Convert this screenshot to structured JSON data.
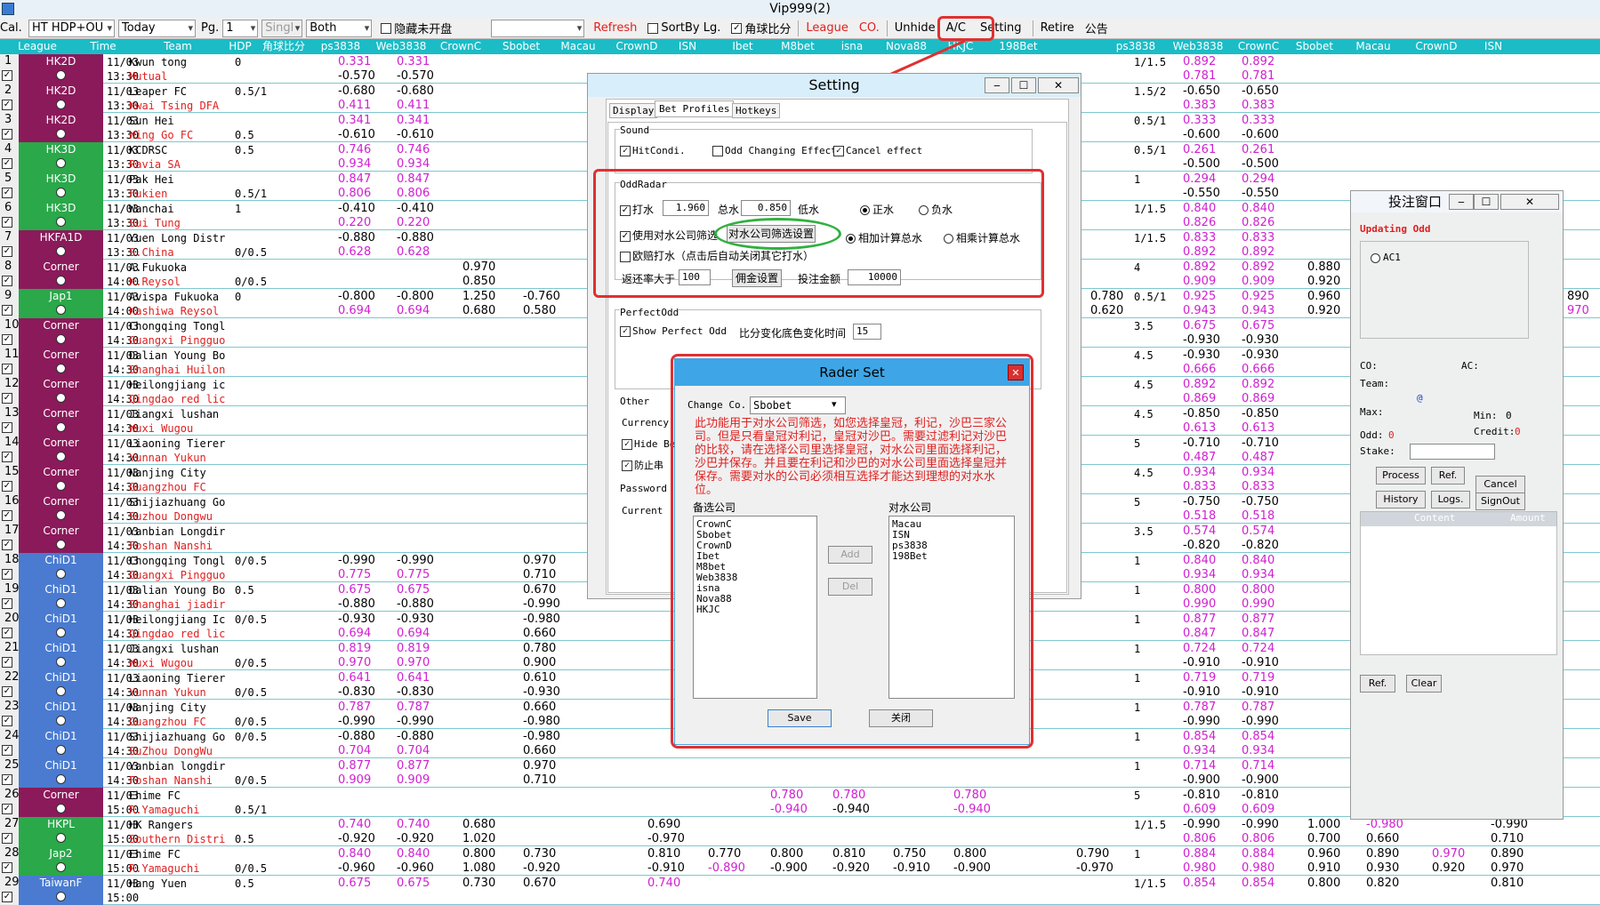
{
  "window": {
    "title": "Vip999(2)"
  },
  "toolbar": {
    "cal": "Cal.",
    "market": "HT HDP+OU",
    "date": "Today",
    "pg_label": "Pg.",
    "page": "1",
    "single": "Singl",
    "both": "Both",
    "hide_unopened": "隐藏未开盘",
    "refresh": "Refresh",
    "sort_by_league": "SortBy Lg.",
    "corner_ratio": "角球比分",
    "league": "League",
    "co": "CO.",
    "unhide": "Unhide",
    "ac": "A/C",
    "setting": "Setting",
    "retire": "Retire",
    "notice": "公告"
  },
  "header": {
    "cols": [
      "League",
      "Time",
      "Team",
      "HDP",
      "角球比分",
      "ps3838",
      "Web3838",
      "CrownC",
      "Sbobet",
      "Macau",
      "CrownD",
      "ISN",
      "Ibet",
      "M8bet",
      "isna",
      "Nova88",
      "HKJC",
      "198Bet",
      "",
      "ps3838",
      "Web3838",
      "CrownC",
      "Sbobet",
      "Macau",
      "CrownD",
      "ISN"
    ]
  },
  "rows": [
    {
      "n": "1",
      "lg": "HK2D",
      "c": "#8b1a5a",
      "d": "11/03",
      "t": "13:30",
      "h": "Kwun tong",
      "a": "Mutual",
      "hdp": "0",
      "hdp2": "",
      "p1": "0.331",
      "p2": "-0.570",
      "w1": "0.331",
      "w2": "-0.570",
      "cc1": "",
      "cc2": "",
      "sb1": "",
      "sb2": "",
      "ou": "1/1.5",
      "r1": "0.892",
      "r2": "0.781",
      "rw1": "0.892",
      "rw2": "0.781"
    },
    {
      "n": "2",
      "lg": "HK2D",
      "c": "#8b1a5a",
      "d": "11/03",
      "t": "13:30",
      "h": "Leaper FC",
      "a": "Kwai Tsing DFA",
      "hdp": "0.5/1",
      "hdp2": "",
      "p1": "-0.680",
      "p2": "0.411",
      "w1": "-0.680",
      "w2": "0.411",
      "cc1": "",
      "cc2": "",
      "sb1": "",
      "sb2": "",
      "ou": "1.5/2",
      "r1": "-0.650",
      "r2": "0.383",
      "rw1": "-0.650",
      "rw2": "0.383"
    },
    {
      "n": "3",
      "lg": "HK2D",
      "c": "#8b1a5a",
      "d": "11/03",
      "t": "13:30",
      "h": "Sun Hei",
      "a": "Wing Go FC",
      "hdp": "",
      "hdp2": "0.5",
      "p1": "0.341",
      "p2": "-0.610",
      "w1": "0.341",
      "w2": "-0.610",
      "cc1": "",
      "cc2": "",
      "sb1": "",
      "sb2": "",
      "ou": "0.5/1",
      "r1": "0.333",
      "r2": "-0.600",
      "rw1": "0.333",
      "rw2": "-0.600"
    },
    {
      "n": "4",
      "lg": "HK3D",
      "c": "#2aa84a",
      "d": "11/03",
      "t": "13:30",
      "h": "KCDRSC",
      "a": "Ravia SA",
      "hdp": "0.5",
      "hdp2": "",
      "p1": "0.746",
      "p2": "0.934",
      "w1": "0.746",
      "w2": "0.934",
      "cc1": "",
      "cc2": "",
      "sb1": "",
      "sb2": "",
      "ou": "0.5/1",
      "r1": "0.261",
      "r2": "-0.500",
      "rw1": "0.261",
      "rw2": "-0.500"
    },
    {
      "n": "5",
      "lg": "HK3D",
      "c": "#2aa84a",
      "d": "11/03",
      "t": "13:30",
      "h": "Pak Hei",
      "a": "Fukien",
      "hdp": "",
      "hdp2": "0.5/1",
      "p1": "0.847",
      "p2": "0.806",
      "w1": "0.847",
      "w2": "0.806",
      "cc1": "",
      "cc2": "",
      "sb1": "",
      "sb2": "",
      "ou": "1",
      "r1": "0.294",
      "r2": "-0.550",
      "rw1": "0.294",
      "rw2": "-0.550"
    },
    {
      "n": "6",
      "lg": "HK3D",
      "c": "#2aa84a",
      "d": "11/03",
      "t": "13:30",
      "h": "Wanchai",
      "a": "Sui Tung",
      "hdp": "1",
      "hdp2": "",
      "p1": "-0.410",
      "p2": "0.220",
      "w1": "-0.410",
      "w2": "0.220",
      "cc1": "",
      "cc2": "",
      "sb1": "",
      "sb2": "",
      "ou": "1/1.5",
      "r1": "0.840",
      "r2": "0.826",
      "rw1": "0.840",
      "rw2": "0.826"
    },
    {
      "n": "7",
      "lg": "HKFA1D",
      "c": "#8b1a5a",
      "d": "11/03",
      "t": "13:30",
      "h": "Yuen Long Distr",
      "a": "S.China",
      "hdp": "",
      "hdp2": "0/0.5",
      "p1": "-0.880",
      "p2": "0.628",
      "w1": "-0.880",
      "w2": "0.628",
      "cc1": "",
      "cc2": "",
      "sb1": "",
      "sb2": "",
      "ou": "1/1.5",
      "r1": "0.833",
      "r2": "0.892",
      "rw1": "0.833",
      "rw2": "0.892"
    },
    {
      "n": "8",
      "lg": "Corner",
      "c": "#8b1a5a",
      "d": "11/03",
      "t": "14:00",
      "h": "A.Fukuoka",
      "a": "K.Reysol",
      "hdp": "",
      "hdp2": "0/0.5",
      "p1": "",
      "p2": "",
      "w1": "",
      "w2": "",
      "cc1": "0.970",
      "cc2": "0.850",
      "sb1": "",
      "sb2": "",
      "ou": "4",
      "r1": "0.892",
      "r2": "0.909",
      "rw1": "0.892",
      "rw2": "0.909"
    },
    {
      "n": "9",
      "lg": "Jap1",
      "c": "#2aa84a",
      "d": "11/03",
      "t": "14:00",
      "h": "Avispa Fukuoka",
      "a": "Kashiwa Reysol",
      "hdp": "0",
      "hdp2": "",
      "p1": "-0.800",
      "p2": "0.694",
      "w1": "-0.800",
      "w2": "0.694",
      "cc1": "1.250",
      "cc2": "0.680",
      "sb1": "-0.760",
      "sb2": "0.580",
      "ou": "0.5/1",
      "r1": "0.925",
      "r2": "0.943",
      "rw1": "0.925",
      "rw2": "0.943"
    },
    {
      "n": "10",
      "lg": "Corner",
      "c": "#8b1a5a",
      "d": "11/03",
      "t": "14:30",
      "h": "Chongqing Tongl",
      "a": "Guangxi Pingguo",
      "hdp": "",
      "hdp2": "",
      "p1": "",
      "p2": "",
      "w1": "",
      "w2": "",
      "cc1": "",
      "cc2": "",
      "sb1": "",
      "sb2": "",
      "ou": "3.5",
      "r1": "0.675",
      "r2": "-0.930",
      "rw1": "0.675",
      "rw2": "-0.930"
    },
    {
      "n": "11",
      "lg": "Corner",
      "c": "#8b1a5a",
      "d": "11/03",
      "t": "14:30",
      "h": "Dalian Young Bo",
      "a": "Shanghai Huilon",
      "hdp": "",
      "hdp2": "",
      "p1": "",
      "p2": "",
      "w1": "",
      "w2": "",
      "cc1": "",
      "cc2": "",
      "sb1": "",
      "sb2": "",
      "ou": "4.5",
      "r1": "-0.930",
      "r2": "0.666",
      "rw1": "-0.930",
      "rw2": "0.666"
    },
    {
      "n": "12",
      "lg": "Corner",
      "c": "#8b1a5a",
      "d": "11/03",
      "t": "14:30",
      "h": "Heilongjiang ic",
      "a": "Qingdao red lic",
      "hdp": "",
      "hdp2": "",
      "p1": "",
      "p2": "",
      "w1": "",
      "w2": "",
      "cc1": "",
      "cc2": "",
      "sb1": "",
      "sb2": "",
      "ou": "4.5",
      "r1": "0.892",
      "r2": "0.869",
      "rw1": "0.892",
      "rw2": "0.869"
    },
    {
      "n": "13",
      "lg": "Corner",
      "c": "#8b1a5a",
      "d": "11/03",
      "t": "14:30",
      "h": "Jiangxi lushan",
      "a": "Wuxi Wugou",
      "hdp": "",
      "hdp2": "",
      "p1": "",
      "p2": "",
      "w1": "",
      "w2": "",
      "cc1": "",
      "cc2": "",
      "sb1": "",
      "sb2": "",
      "ou": "4.5",
      "r1": "-0.850",
      "r2": "0.613",
      "rw1": "-0.850",
      "rw2": "0.613"
    },
    {
      "n": "14",
      "lg": "Corner",
      "c": "#8b1a5a",
      "d": "11/03",
      "t": "14:30",
      "h": "Liaoning Tierer",
      "a": "Yunnan Yukun",
      "hdp": "",
      "hdp2": "",
      "p1": "",
      "p2": "",
      "w1": "",
      "w2": "",
      "cc1": "",
      "cc2": "",
      "sb1": "",
      "sb2": "",
      "ou": "5",
      "r1": "-0.710",
      "r2": "0.487",
      "rw1": "-0.710",
      "rw2": "0.487"
    },
    {
      "n": "15",
      "lg": "Corner",
      "c": "#8b1a5a",
      "d": "11/03",
      "t": "14:30",
      "h": "Nanjing City",
      "a": "Guangzhou FC",
      "hdp": "",
      "hdp2": "",
      "p1": "",
      "p2": "",
      "w1": "",
      "w2": "",
      "cc1": "",
      "cc2": "",
      "sb1": "",
      "sb2": "",
      "ou": "4.5",
      "r1": "0.934",
      "r2": "0.833",
      "rw1": "0.934",
      "rw2": "0.833"
    },
    {
      "n": "16",
      "lg": "Corner",
      "c": "#8b1a5a",
      "d": "11/03",
      "t": "14:30",
      "h": "Shijiazhuang Go",
      "a": "Suzhou Dongwu",
      "hdp": "",
      "hdp2": "",
      "p1": "",
      "p2": "",
      "w1": "",
      "w2": "",
      "cc1": "",
      "cc2": "",
      "sb1": "",
      "sb2": "",
      "ou": "5",
      "r1": "-0.750",
      "r2": "0.518",
      "rw1": "-0.750",
      "rw2": "0.518"
    },
    {
      "n": "17",
      "lg": "Corner",
      "c": "#8b1a5a",
      "d": "11/03",
      "t": "14:30",
      "h": "Yanbian Longdir",
      "a": "Foshan Nanshi",
      "hdp": "",
      "hdp2": "",
      "p1": "",
      "p2": "",
      "w1": "",
      "w2": "",
      "cc1": "",
      "cc2": "",
      "sb1": "",
      "sb2": "",
      "ou": "3.5",
      "r1": "0.574",
      "r2": "-0.820",
      "rw1": "0.574",
      "rw2": "-0.820"
    },
    {
      "n": "18",
      "lg": "ChiD1",
      "c": "#4a7bd0",
      "d": "11/03",
      "t": "14:30",
      "h": "Chongqing Tongl",
      "a": "Guangxi Pingguo",
      "hdp": "0/0.5",
      "hdp2": "",
      "p1": "-0.990",
      "p2": "0.775",
      "w1": "-0.990",
      "w2": "0.775",
      "cc1": "",
      "cc2": "",
      "sb1": "0.970",
      "sb2": "0.710",
      "ou": "1",
      "r1": "0.840",
      "r2": "0.934",
      "rw1": "0.840",
      "rw2": "0.934"
    },
    {
      "n": "19",
      "lg": "ChiD1",
      "c": "#4a7bd0",
      "d": "11/03",
      "t": "14:30",
      "h": "Dalian Young Bo",
      "a": "Shanghai jiadir",
      "hdp": "0.5",
      "hdp2": "",
      "p1": "0.675",
      "p2": "-0.880",
      "w1": "0.675",
      "w2": "-0.880",
      "cc1": "",
      "cc2": "",
      "sb1": "0.670",
      "sb2": "-0.990",
      "ou": "1",
      "r1": "0.800",
      "r2": "0.990",
      "rw1": "0.800",
      "rw2": "0.990"
    },
    {
      "n": "20",
      "lg": "ChiD1",
      "c": "#4a7bd0",
      "d": "11/03",
      "t": "14:30",
      "h": "Heilongjiang Ic",
      "a": "Qingdao red lic",
      "hdp": "0/0.5",
      "hdp2": "",
      "p1": "-0.930",
      "p2": "0.694",
      "w1": "-0.930",
      "w2": "0.694",
      "cc1": "",
      "cc2": "",
      "sb1": "-0.980",
      "sb2": "0.660",
      "ou": "1",
      "r1": "0.877",
      "r2": "0.847",
      "rw1": "0.877",
      "rw2": "0.847"
    },
    {
      "n": "21",
      "lg": "ChiD1",
      "c": "#4a7bd0",
      "d": "11/03",
      "t": "14:30",
      "h": "Jiangxi lushan",
      "a": "Wuxi Wugou",
      "hdp": "",
      "hdp2": "0/0.5",
      "p1": "0.819",
      "p2": "0.970",
      "w1": "0.819",
      "w2": "0.970",
      "cc1": "",
      "cc2": "",
      "sb1": "0.780",
      "sb2": "0.900",
      "ou": "1",
      "r1": "0.724",
      "r2": "-0.910",
      "rw1": "0.724",
      "rw2": "-0.910"
    },
    {
      "n": "22",
      "lg": "ChiD1",
      "c": "#4a7bd0",
      "d": "11/03",
      "t": "14:30",
      "h": "Liaoning Tierer",
      "a": "Yunnan Yukun",
      "hdp": "",
      "hdp2": "0/0.5",
      "p1": "0.641",
      "p2": "-0.830",
      "w1": "0.641",
      "w2": "-0.830",
      "cc1": "",
      "cc2": "",
      "sb1": "0.610",
      "sb2": "-0.930",
      "ou": "1",
      "r1": "0.719",
      "r2": "-0.910",
      "rw1": "0.719",
      "rw2": "-0.910"
    },
    {
      "n": "23",
      "lg": "ChiD1",
      "c": "#4a7bd0",
      "d": "11/03",
      "t": "14:30",
      "h": "Nanjing City",
      "a": "Guangzhou FC",
      "hdp": "",
      "hdp2": "0/0.5",
      "p1": "0.787",
      "p2": "-0.990",
      "w1": "0.787",
      "w2": "-0.990",
      "cc1": "",
      "cc2": "",
      "sb1": "0.660",
      "sb2": "-0.980",
      "ou": "1",
      "r1": "0.787",
      "r2": "-0.990",
      "rw1": "0.787",
      "rw2": "-0.990"
    },
    {
      "n": "24",
      "lg": "ChiD1",
      "c": "#4a7bd0",
      "d": "11/03",
      "t": "14:30",
      "h": "Shijiazhuang Go",
      "a": "SuZhou DongWu",
      "hdp": "0/0.5",
      "hdp2": "",
      "p1": "-0.880",
      "p2": "0.704",
      "w1": "-0.880",
      "w2": "0.704",
      "cc1": "",
      "cc2": "",
      "sb1": "-0.980",
      "sb2": "0.660",
      "ou": "1",
      "r1": "0.854",
      "r2": "0.934",
      "rw1": "0.854",
      "rw2": "0.934"
    },
    {
      "n": "25",
      "lg": "ChiD1",
      "c": "#4a7bd0",
      "d": "11/03",
      "t": "14:30",
      "h": "Yanbian longdir",
      "a": "Foshan Nanshi",
      "hdp": "",
      "hdp2": "0/0.5",
      "p1": "0.877",
      "p2": "0.909",
      "w1": "0.877",
      "w2": "0.909",
      "cc1": "",
      "cc2": "",
      "sb1": "0.970",
      "sb2": "0.710",
      "ou": "1",
      "r1": "0.714",
      "r2": "-0.900",
      "rw1": "0.714",
      "rw2": "-0.900"
    },
    {
      "n": "26",
      "lg": "Corner",
      "c": "#8b1a5a",
      "d": "11/03",
      "t": "15:00",
      "h": "Ehime FC",
      "a": "R.Yamaguchi",
      "hdp": "",
      "hdp2": "0.5/1",
      "p1": "",
      "p2": "",
      "w1": "",
      "w2": "",
      "cc1": "",
      "cc2": "",
      "sb1": "",
      "sb2": "",
      "ou": "5",
      "r1": "-0.810",
      "r2": "0.609",
      "rw1": "-0.810",
      "rw2": "0.609"
    },
    {
      "n": "27",
      "lg": "HKPL",
      "c": "#2aa84a",
      "d": "11/03",
      "t": "15:00",
      "h": "HK Rangers",
      "a": "Southern Distri",
      "hdp": "",
      "hdp2": "0.5",
      "p1": "0.740",
      "p2": "-0.920",
      "w1": "0.740",
      "w2": "-0.920",
      "cc1": "0.680",
      "cc2": "1.020",
      "sb1": "",
      "sb2": "",
      "ou": "1/1.5",
      "r1": "-0.990",
      "r2": "0.806",
      "rw1": "-0.990",
      "rw2": "0.806"
    },
    {
      "n": "28",
      "lg": "Jap2",
      "c": "#2aa84a",
      "d": "11/03",
      "t": "15:00",
      "h": "Ehime FC",
      "a": "R.Yamaguchi",
      "hdp": "",
      "hdp2": "0/0.5",
      "p1": "0.840",
      "p2": "-0.960",
      "w1": "0.840",
      "w2": "-0.960",
      "cc1": "0.800",
      "cc2": "1.080",
      "sb1": "0.730",
      "sb2": "-0.920",
      "ou": "1",
      "r1": "0.884",
      "r2": "0.980",
      "rw1": "0.884",
      "rw2": "0.980"
    },
    {
      "n": "29",
      "lg": "TaiwanF",
      "c": "#4a7bd0",
      "d": "11/03",
      "t": "15:00",
      "h": "Hang Yuen",
      "a": "",
      "hdp": "0.5",
      "hdp2": "",
      "p1": "0.675",
      "p2": "",
      "w1": "0.675",
      "w2": "",
      "cc1": "0.730",
      "cc2": "",
      "sb1": "0.670",
      "sb2": "",
      "ou": "1/1.5",
      "r1": "0.854",
      "r2": "",
      "rw1": "0.854",
      "rw2": ""
    }
  ],
  "extra_odds": {
    "r9_left": "0.780",
    "r9_left2": "0.620",
    "r9_right": "890",
    "r9_right2": "970",
    "r8_cc": "0.880",
    "r8_cc2": "0.920",
    "r9_cc": "0.960",
    "r9_cc2": "0.920",
    "r26_ib": "0.780",
    "r26_ib2": "-0.940",
    "r26_m8": "0.780",
    "r26_m82": "-0.940",
    "r26_nv": "0.780",
    "r26_nv2": "-0.940",
    "r27_cd": "0.690",
    "r27_cd2": "-0.970",
    "r27_rc": "1.000",
    "r27_rc2": "0.700",
    "r27_rs": "-0.980",
    "r27_rs2": "0.660",
    "r27_rcd": "-0.990",
    "r27_rcd2": "0.710",
    "r28_cd": "0.810",
    "r28_cd2": "-0.910",
    "r28_isn": "0.770",
    "r28_isn2": "-0.890",
    "r28_ib": "0.800",
    "r28_ib2": "-0.900",
    "r28_m8": "0.810",
    "r28_m82": "-0.920",
    "r28_is": "0.750",
    "r28_is2": "-0.910",
    "r28_nv": "0.800",
    "r28_nv2": "-0.900",
    "r28_198": "0.790",
    "r28_1982": "-0.970",
    "r28_rc": "0.960",
    "r28_rc2": "0.910",
    "r28_rs": "0.890",
    "r28_rs2": "0.930",
    "r28_rm": "0.970",
    "r28_rm2": "0.920",
    "r28_rcd": "0.890",
    "r28_rcd2": "0.970",
    "r29_cd": "0.740",
    "r29_rc": "0.800",
    "r29_rs": "0.820",
    "r29_rcd": "0.810"
  },
  "setting": {
    "title": "Setting",
    "tabs": [
      "Display",
      "Bet Profiles",
      "Hotkeys"
    ],
    "sound": "Sound",
    "hitcondi": "HitCondi.",
    "odd_change": "Odd Changing Effect",
    "cancel_effect": "Cancel effect",
    "oddradar": "OddRadar",
    "dashui": "打水",
    "dashui_val": "1.960",
    "zongshui": "总水",
    "zongshui_val": "0.850",
    "dishui": "低水",
    "zheng": "正水",
    "fu": "负水",
    "use_filter": "使用对水公司筛选",
    "filter_btn": "对水公司筛选设置",
    "add_calc": "相加计算总水",
    "mul_calc": "相乘计算总水",
    "eu": "欧赔打水（点击后自动关闭其它打水）",
    "rebate": "返还率大于",
    "rebate_val": "100",
    "fund_btn": "佣金设置",
    "stake": "投注金额",
    "stake_val": "10000",
    "perfect": "PerfectOdd",
    "show_perfect": "Show Perfect Odd",
    "score_time": "比分变化底色变化时间",
    "score_time_val": "15",
    "other": "Other",
    "currency": "Currency",
    "hide": "Hide Be",
    "prevent": "防止串",
    "password": "Password",
    "current": "Current"
  },
  "rader": {
    "title": "Rader Set",
    "change_co": "Change Co.",
    "company": "Sbobet",
    "desc": "此功能用于对水公司筛选，如您选择皇冠，利记，沙巴三家公司。但是只看皇冠对利记，皇冠对沙巴。需要过滤利记对沙巴的比较，请在选择公司里选择皇冠，对水公司里面选择利记，沙巴并保存。并且要在利记和沙巴的对水公司里面选择皇冠并保存。需要对水的公司必须相互选择才能达到理想的对水水位。",
    "avail_label": "备选公司",
    "target_label": "对水公司",
    "avail": [
      "CrownC",
      "Sbobet",
      "CrownD",
      "Ibet",
      "M8bet",
      "Web3838",
      "isna",
      "Nova88",
      "HKJC"
    ],
    "targets": [
      "Macau",
      "ISN",
      "ps3838",
      "198Bet"
    ],
    "add": "Add",
    "del": "Del",
    "save": "Save",
    "close": "关闭"
  },
  "bet": {
    "title": "投注窗口",
    "updating": "Updating Odd",
    "ac1": "AC1",
    "co": "CO:",
    "ac": "AC:",
    "team": "Team:",
    "at": "@",
    "max": "Max:",
    "min": "Min:",
    "min_val": "0",
    "odd": "Odd:",
    "odd_val": "0",
    "credit": "Credit:",
    "credit_val": "0",
    "stake": "Stake:",
    "process": "Process",
    "ref": "Ref.",
    "cancel": "Cancel",
    "history": "History",
    "logs": "Logs.",
    "signout": "SignOut",
    "content": "Content",
    "amount": "Amount",
    "ref2": "Ref.",
    "clear": "Clear"
  }
}
